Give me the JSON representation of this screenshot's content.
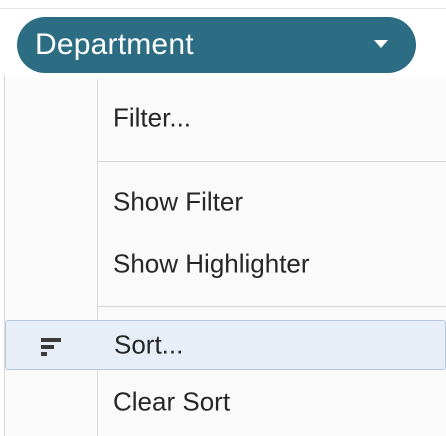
{
  "pill": {
    "label": "Department",
    "icon": "chevron-down-icon"
  },
  "menu": {
    "items": [
      {
        "label": "Filter..."
      },
      {
        "label": "Show Filter"
      },
      {
        "label": "Show Highlighter"
      },
      {
        "label": "Sort...",
        "icon": "sort-icon",
        "highlighted": true
      },
      {
        "label": "Clear Sort"
      }
    ]
  },
  "colors": {
    "pill_bg": "#2d6d83",
    "menu_bg": "#fafafa",
    "highlight_bg": "#e7eef7",
    "highlight_border": "#b7c9df"
  }
}
